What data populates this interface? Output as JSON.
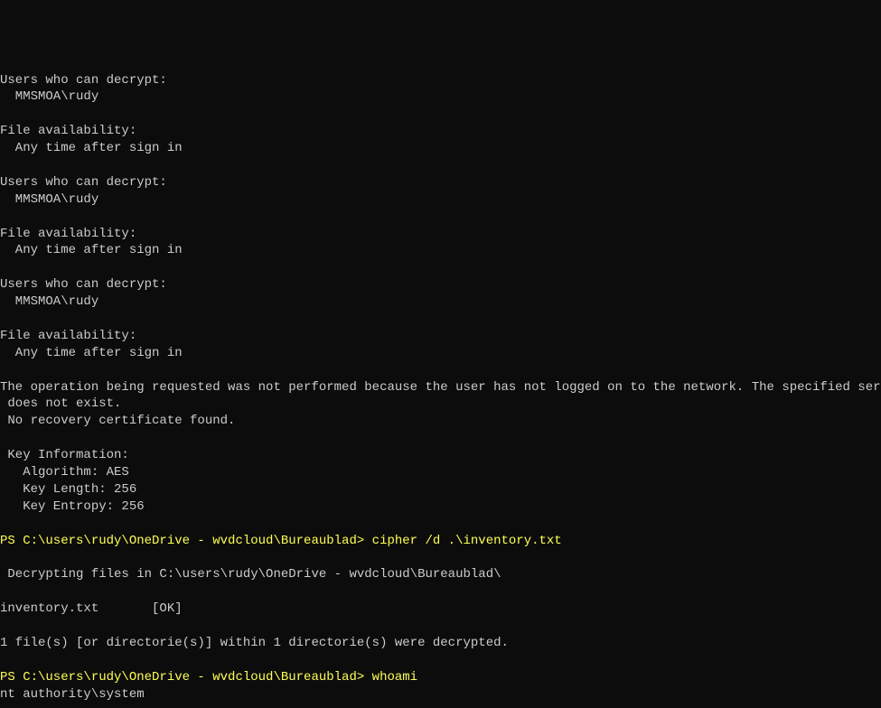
{
  "terminal": {
    "lines": [
      {
        "type": "output",
        "text": "Users who can decrypt:"
      },
      {
        "type": "output",
        "text": "  MMSMOA\\rudy"
      },
      {
        "type": "blank",
        "text": ""
      },
      {
        "type": "output",
        "text": "File availability:"
      },
      {
        "type": "output",
        "text": "  Any time after sign in"
      },
      {
        "type": "blank",
        "text": ""
      },
      {
        "type": "output",
        "text": "Users who can decrypt:"
      },
      {
        "type": "output",
        "text": "  MMSMOA\\rudy"
      },
      {
        "type": "blank",
        "text": ""
      },
      {
        "type": "output",
        "text": "File availability:"
      },
      {
        "type": "output",
        "text": "  Any time after sign in"
      },
      {
        "type": "blank",
        "text": ""
      },
      {
        "type": "output",
        "text": "Users who can decrypt:"
      },
      {
        "type": "output",
        "text": "  MMSMOA\\rudy"
      },
      {
        "type": "blank",
        "text": ""
      },
      {
        "type": "output",
        "text": "File availability:"
      },
      {
        "type": "output",
        "text": "  Any time after sign in"
      },
      {
        "type": "blank",
        "text": ""
      },
      {
        "type": "output",
        "text": "The operation being requested was not performed because the user has not logged on to the network. The specified servic"
      },
      {
        "type": "output",
        "text": " does not exist."
      },
      {
        "type": "output",
        "text": " No recovery certificate found."
      },
      {
        "type": "blank",
        "text": ""
      },
      {
        "type": "output",
        "text": " Key Information:"
      },
      {
        "type": "output",
        "text": "   Algorithm: AES"
      },
      {
        "type": "output",
        "text": "   Key Length: 256"
      },
      {
        "type": "output",
        "text": "   Key Entropy: 256"
      },
      {
        "type": "blank",
        "text": ""
      },
      {
        "type": "prompt-line",
        "prompt": "PS C:\\users\\rudy\\OneDrive - wvdcloud\\Bureaublad> ",
        "command": "cipher /d .\\inventory.txt"
      },
      {
        "type": "blank",
        "text": ""
      },
      {
        "type": "output",
        "text": " Decrypting files in C:\\users\\rudy\\OneDrive - wvdcloud\\Bureaublad\\"
      },
      {
        "type": "blank",
        "text": ""
      },
      {
        "type": "output",
        "text": "inventory.txt       [OK]"
      },
      {
        "type": "blank",
        "text": ""
      },
      {
        "type": "output",
        "text": "1 file(s) [or directorie(s)] within 1 directorie(s) were decrypted."
      },
      {
        "type": "blank",
        "text": ""
      },
      {
        "type": "prompt-line",
        "prompt": "PS C:\\users\\rudy\\OneDrive - wvdcloud\\Bureaublad> ",
        "command": "whoami"
      },
      {
        "type": "output",
        "text": "nt authority\\system"
      }
    ]
  }
}
